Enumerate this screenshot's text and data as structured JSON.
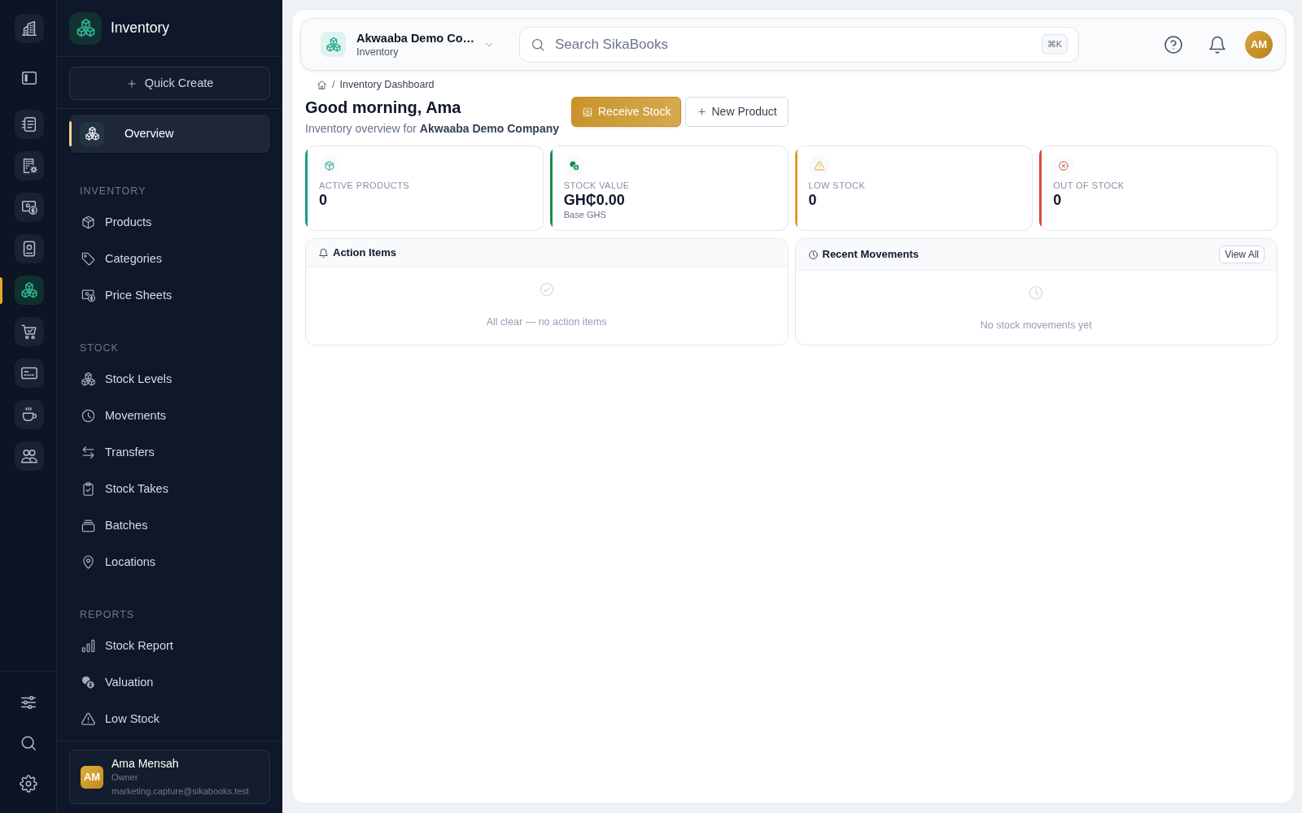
{
  "rail": {
    "items": [
      {
        "kind": "module",
        "selected": false
      },
      {
        "kind": "toggle",
        "selected": false
      },
      {
        "kind": "module",
        "selected": false
      },
      {
        "kind": "module",
        "selected": false
      },
      {
        "kind": "module",
        "selected": false
      },
      {
        "kind": "module",
        "selected": false
      },
      {
        "kind": "module",
        "selected": true
      },
      {
        "kind": "module",
        "selected": false
      },
      {
        "kind": "module",
        "selected": false
      },
      {
        "kind": "module",
        "selected": false
      },
      {
        "kind": "module",
        "selected": false
      }
    ]
  },
  "sidebar": {
    "title": "Inventory",
    "quick_create": "Quick Create",
    "sections": [
      {
        "items": [
          {
            "label": "Overview",
            "selected": true
          }
        ]
      },
      {
        "heading": "INVENTORY",
        "items": [
          {
            "label": "Products",
            "selected": false
          },
          {
            "label": "Categories",
            "selected": false
          },
          {
            "label": "Price Sheets",
            "selected": false
          }
        ]
      },
      {
        "heading": "STOCK",
        "items": [
          {
            "label": "Stock Levels",
            "selected": false
          },
          {
            "label": "Movements",
            "selected": false
          },
          {
            "label": "Transfers",
            "selected": false
          },
          {
            "label": "Stock Takes",
            "selected": false
          },
          {
            "label": "Batches",
            "selected": false
          },
          {
            "label": "Locations",
            "selected": false
          }
        ]
      },
      {
        "heading": "REPORTS",
        "items": [
          {
            "label": "Stock Report",
            "selected": false
          },
          {
            "label": "Valuation",
            "selected": false
          },
          {
            "label": "Low Stock",
            "selected": false
          }
        ]
      }
    ],
    "user": {
      "initials": "AM",
      "name": "Ama Mensah",
      "role": "Owner",
      "email": "marketing.capture@sikabooks.test"
    }
  },
  "top_bar": {
    "company": {
      "name": "Akwaaba Demo Co…",
      "module": "Inventory"
    },
    "search": {
      "placeholder": "Search SikaBooks",
      "shortcut": "⌘K"
    },
    "avatar": {
      "initials": "AM"
    }
  },
  "breadcrumb": {
    "separator": "/",
    "current": "Inventory Dashboard"
  },
  "greeting": {
    "title": "Good morning, Ama",
    "subtitle": "Inventory overview for **Akwaaba Demo Company**"
  },
  "actions": [
    {
      "kind": "primary",
      "label": "Receive Stock"
    },
    {
      "kind": "secondary",
      "label": "New Product"
    }
  ],
  "stats": [
    {
      "label": "ACTIVE PRODUCTS",
      "value": "0",
      "color": "#1c9e84"
    },
    {
      "label": "STOCK VALUE",
      "value": "GH₵0.00",
      "note": "Base GHS",
      "color": "#178a4c"
    },
    {
      "label": "LOW STOCK",
      "value": "0",
      "color": "#e39b26"
    },
    {
      "label": "OUT OF STOCK",
      "value": "0",
      "color": "#d9473f"
    }
  ],
  "panels": [
    {
      "title": "Action Items",
      "empty_text": "All clear — no action items"
    },
    {
      "title": "Recent Movements",
      "button": "View All",
      "empty_text": "No stock movements yet"
    }
  ]
}
